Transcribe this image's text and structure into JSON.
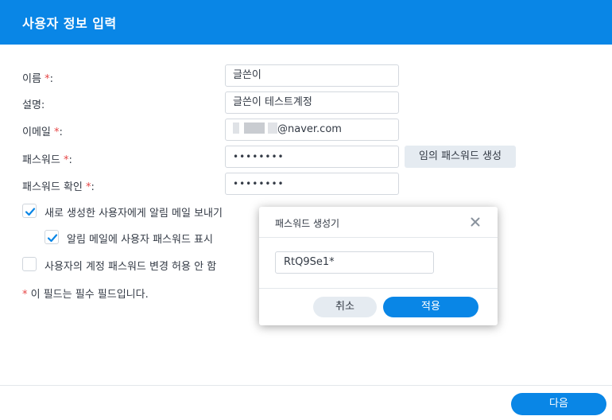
{
  "header": {
    "title": "사용자 정보 입력"
  },
  "form": {
    "required_mark": "*",
    "name": {
      "label": "이름",
      "colon": ":",
      "value": "글쓴이"
    },
    "description": {
      "label": "설명:",
      "value": "글쓴이 테스트계정"
    },
    "email": {
      "label": "이메일",
      "colon": ":",
      "value": "@naver.com"
    },
    "password": {
      "label": "패스워드",
      "colon": ":",
      "value": "••••••••"
    },
    "password_confirm": {
      "label": "패스워드 확인",
      "colon": ":",
      "value": "••••••••"
    },
    "generate_button": "임의 패스워드 생성"
  },
  "checkboxes": [
    {
      "label": "새로 생성한 사용자에게 알림 메일 보내기",
      "checked": true
    },
    {
      "label": "알림 메일에 사용자 패스워드 표시",
      "checked": true
    },
    {
      "label": "사용자의 계정 패스워드 변경 허용 안 함",
      "checked": false
    }
  ],
  "note": {
    "mark": "*",
    "text": " 이 필드는 필수 필드입니다."
  },
  "footer": {
    "next_button": "다음"
  },
  "dialog": {
    "title": "패스워드 생성기",
    "close_icon": "close-icon",
    "generated_password": "RtQ9Se1*",
    "cancel_button": "취소",
    "apply_button": "적용"
  },
  "colors": {
    "accent": "#0986e6",
    "required": "#e64545",
    "secondary_button": "#e5ebf1"
  }
}
